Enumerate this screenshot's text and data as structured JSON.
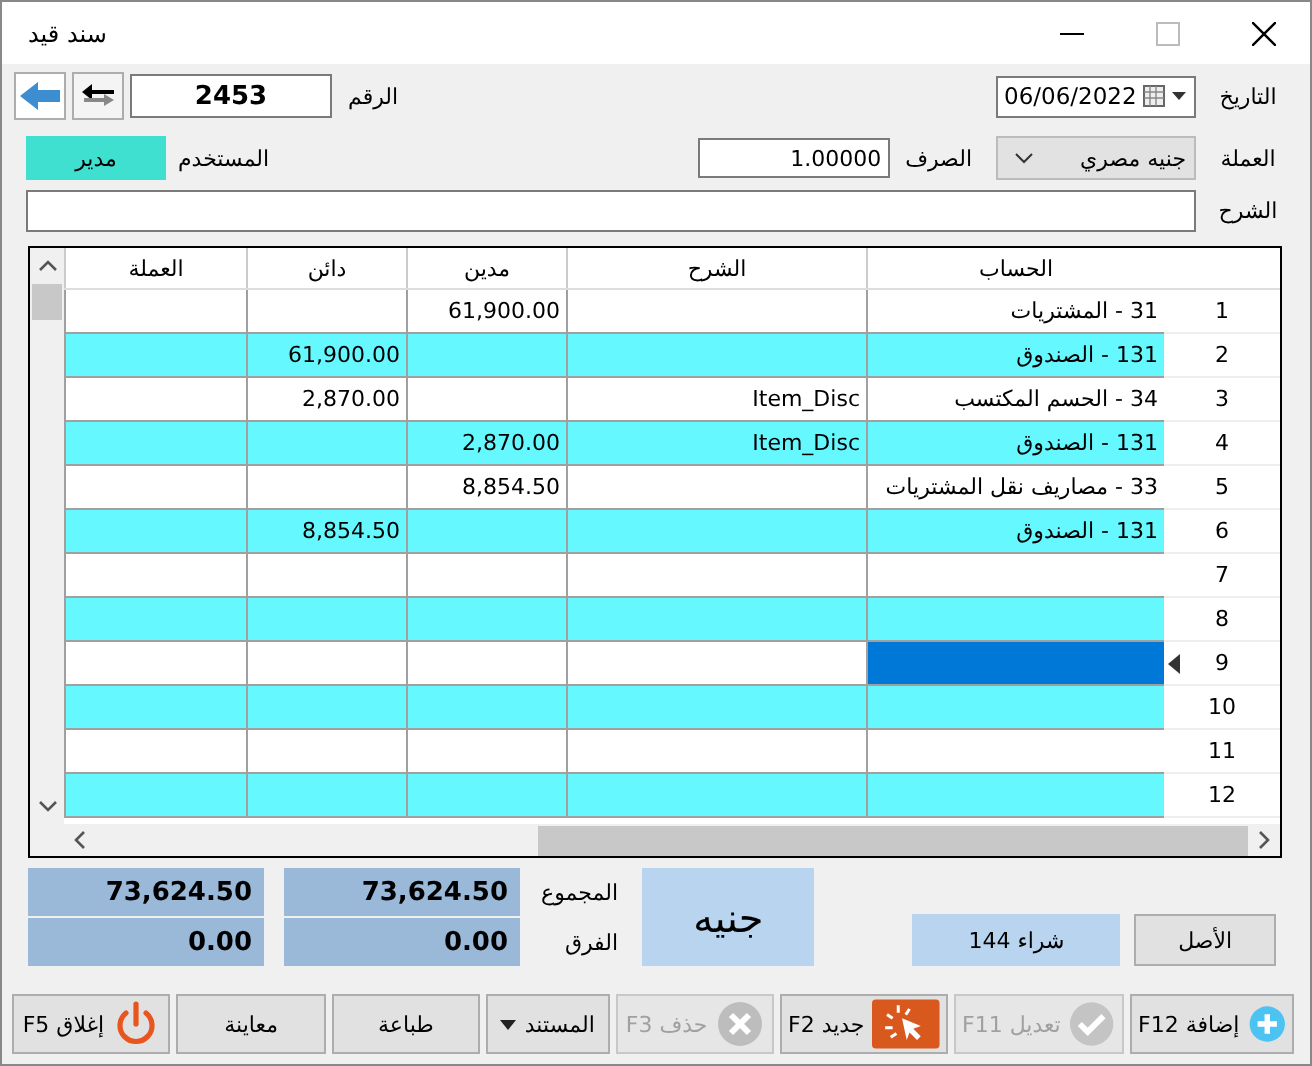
{
  "window": {
    "title": "سند قيد"
  },
  "header": {
    "date_label": "التاريخ",
    "date": "06/06/2022",
    "number_label": "الرقم",
    "number": "2453",
    "currency_label": "العملة",
    "currency": "جنيه مصري",
    "rate_label": "الصرف",
    "rate": "1.00000",
    "user_label": "المستخدم",
    "user": "مدير",
    "description_label": "الشرح"
  },
  "table": {
    "columns": [
      "الحساب",
      "الشرح",
      "مدين",
      "دائن",
      "العملة"
    ],
    "rows": [
      {
        "number": "1",
        "account": "31 - المشتريات",
        "debit": "61,900.00",
        "selected": false
      },
      {
        "number": "2",
        "account": "131 - الصندوق",
        "credit": "61,900.00",
        "selected": false
      },
      {
        "number": "3",
        "account": "34 - الحسم المكتسب",
        "description": "Item_Disc",
        "credit": "2,870.00",
        "selected": false
      },
      {
        "number": "4",
        "account": "131 - الصندوق",
        "description": "Item_Disc",
        "debit": "2,870.00",
        "selected": false
      },
      {
        "number": "5",
        "account": "33 - مصاريف نقل المشتريات",
        "debit": "8,854.50",
        "selected": false
      },
      {
        "number": "6",
        "account": "131 - الصندوق",
        "credit": "8,854.50",
        "selected": false
      },
      {
        "number": "7",
        "selected": false
      },
      {
        "number": "8",
        "selected": false
      },
      {
        "number": "9",
        "selected": true
      },
      {
        "number": "10",
        "selected": false
      },
      {
        "number": "11",
        "selected": false
      },
      {
        "number": "12",
        "selected": false
      }
    ]
  },
  "totals": {
    "rows": [
      {
        "label": "المجموع",
        "values": [
          "73,624.50",
          "73,624.50"
        ]
      },
      {
        "label": "الفرق",
        "values": [
          "0.00",
          "0.00"
        ]
      }
    ],
    "currency": "جنيه",
    "reference": "شراء 144",
    "origin_button": "الأصل"
  },
  "buttons": [
    {
      "kind": "add",
      "label": "إضافة F12",
      "disabled": false
    },
    {
      "kind": "edit",
      "label": "تعديل F11",
      "disabled": true
    },
    {
      "kind": "new",
      "label": "جديد F2",
      "disabled": false
    },
    {
      "kind": "delete",
      "label": "حذف F3",
      "disabled": true
    },
    {
      "kind": "menu",
      "label": "المستند",
      "disabled": false
    },
    {
      "kind": "plain",
      "label": "طباعة",
      "disabled": false
    },
    {
      "kind": "plain",
      "label": "معاينة",
      "disabled": false
    },
    {
      "kind": "close",
      "label": "إغلاق F5",
      "disabled": false
    }
  ]
}
